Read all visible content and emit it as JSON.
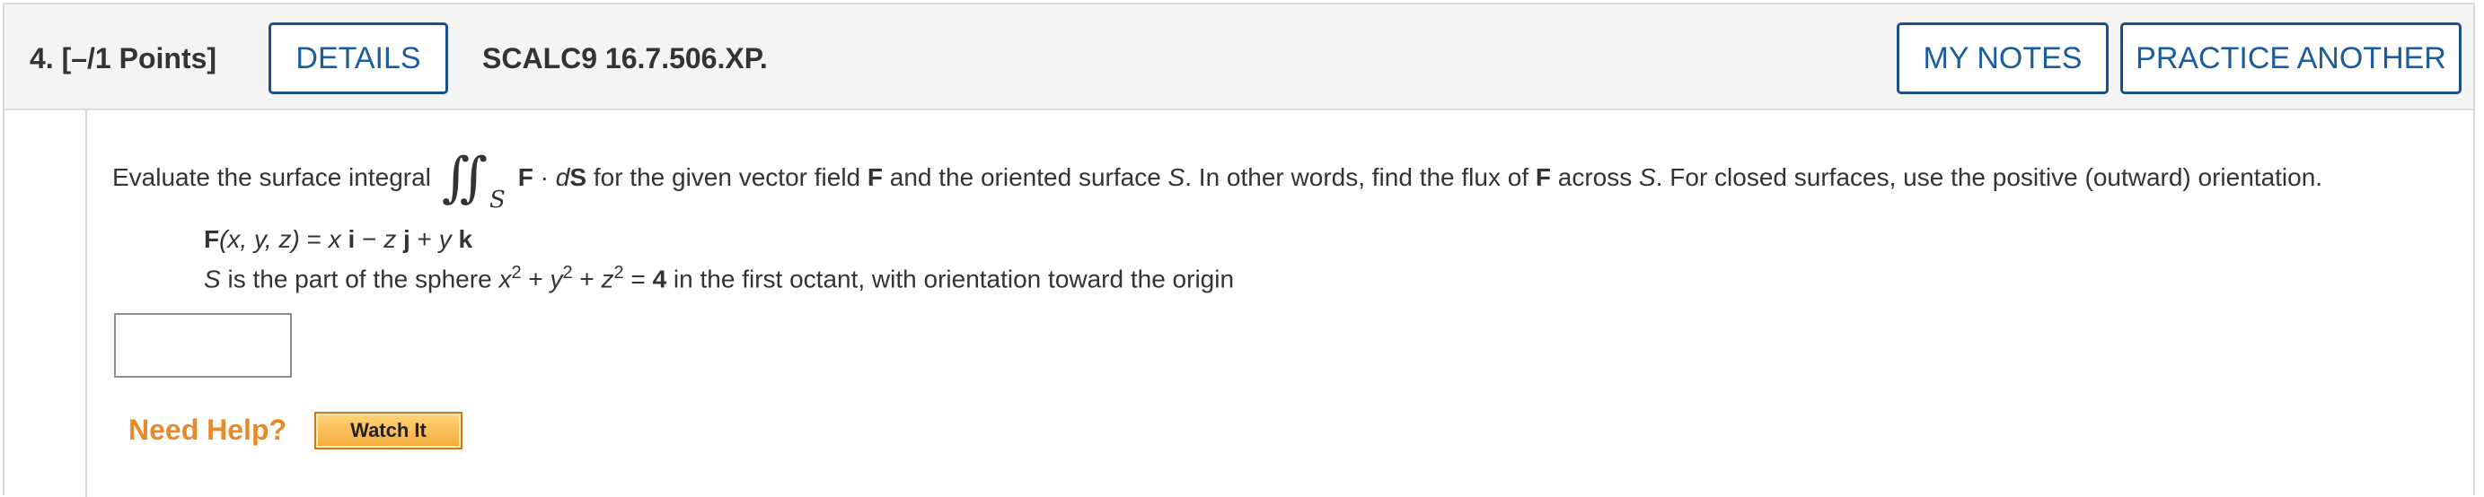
{
  "header": {
    "question_number": "4.",
    "points": "[–/1 Points]",
    "details_label": "DETAILS",
    "problem_code": "SCALC9 16.7.506.XP.",
    "my_notes_label": "MY NOTES",
    "practice_another_label": "PRACTICE ANOTHER"
  },
  "problem": {
    "intro": "Evaluate the surface integral",
    "integral_sub": "S",
    "integrand_F": "F",
    "integrand_dot": " · ",
    "integrand_d": "d",
    "integrand_S": "S",
    "rest": " for the given vector field ",
    "F_bold": "F",
    "rest2": " and the oriented surface ",
    "S_italic": "S",
    "rest3": ". In other words, find the flux of ",
    "F_bold2": "F",
    "rest4": " across ",
    "S_italic2": "S",
    "rest5": ". For closed surfaces, use the positive (outward) orientation.",
    "field_F": "F",
    "field_args": "(x, y, z)",
    "field_eq": " = ",
    "field_x": "x",
    "field_i": " i",
    "field_minus": " − ",
    "field_z": "z",
    "field_j": " j",
    "field_plus": " + ",
    "field_y": "y",
    "field_k": " k",
    "surface_S": "S",
    "surface_text": " is the part of the sphere ",
    "surface_x": "x",
    "surface_y": "y",
    "surface_z": "z",
    "surface_exp": "2",
    "surface_plus": " + ",
    "surface_eq": " = ",
    "surface_val": "4",
    "surface_tail": " in the first octant, with orientation toward the origin"
  },
  "answer": {
    "value": ""
  },
  "help": {
    "label": "Need Help?",
    "watch_label": "Watch It"
  },
  "colors": {
    "button_border": "#1b4f8a",
    "help_orange": "#e8892b",
    "watch_bg": "#f3aa3c"
  }
}
